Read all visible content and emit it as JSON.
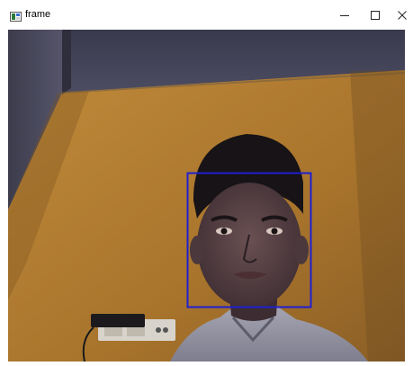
{
  "window": {
    "title": "frame",
    "icons": {
      "app": "opencv-window-icon",
      "minimize": "minimize-icon",
      "maximize": "maximize-icon",
      "close": "close-icon"
    }
  },
  "frame": {
    "description_kind": "webcam-frame",
    "detection_box": {
      "label": "face",
      "color": "#1f1fd0"
    }
  }
}
